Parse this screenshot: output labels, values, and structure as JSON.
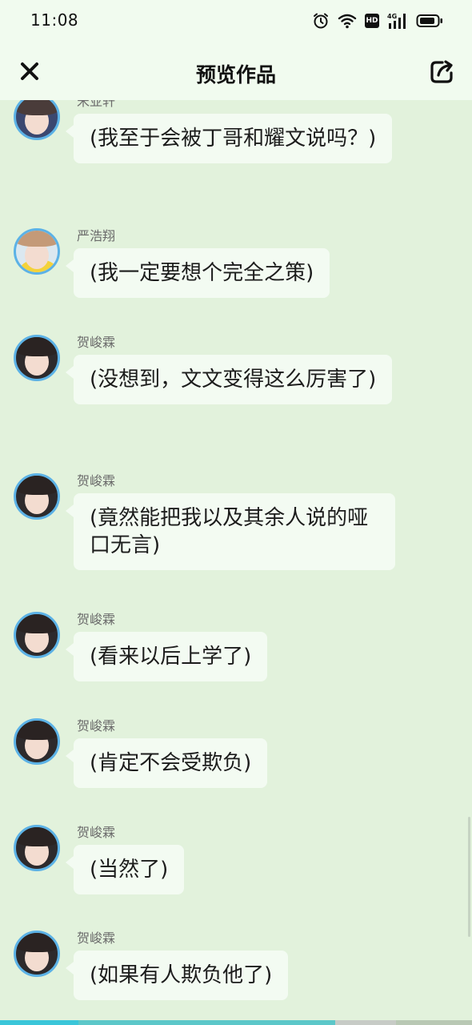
{
  "status_bar": {
    "time": "11:08",
    "icons": [
      "alarm-icon",
      "wifi-icon",
      "hd-icon",
      "signal-4g-icon",
      "battery-icon"
    ],
    "hd": "HD",
    "network": "4G"
  },
  "header": {
    "title": "预览作品",
    "close_icon": "close-icon",
    "share_icon": "share-icon"
  },
  "messages": [
    {
      "sender": "宋亚轩",
      "text": "(我至于会被丁哥和耀文说吗？)",
      "avatar": "song"
    },
    {
      "sender": "严浩翔",
      "text": "(我一定要想个完全之策)",
      "avatar": "yan"
    },
    {
      "sender": "贺峻霖",
      "text": "(没想到，文文变得这么厉害了)",
      "avatar": "he"
    },
    {
      "sender": "贺峻霖",
      "text": "(竟然能把我以及其余人说的哑口无言)",
      "avatar": "he"
    },
    {
      "sender": "贺峻霖",
      "text": "(看来以后上学了)",
      "avatar": "he"
    },
    {
      "sender": "贺峻霖",
      "text": "(肯定不会受欺负)",
      "avatar": "he"
    },
    {
      "sender": "贺峻霖",
      "text": "(当然了)",
      "avatar": "he"
    },
    {
      "sender": "贺峻霖",
      "text": "(如果有人欺负他了)",
      "avatar": "he"
    }
  ],
  "progress": {
    "played_fraction": 0.71
  },
  "colors": {
    "background": "#e2f2dc",
    "header": "#f1fbef",
    "bubble": "#f3fbf2",
    "avatar_ring": "#5cb2e6",
    "progress": "#3bc6d9"
  }
}
